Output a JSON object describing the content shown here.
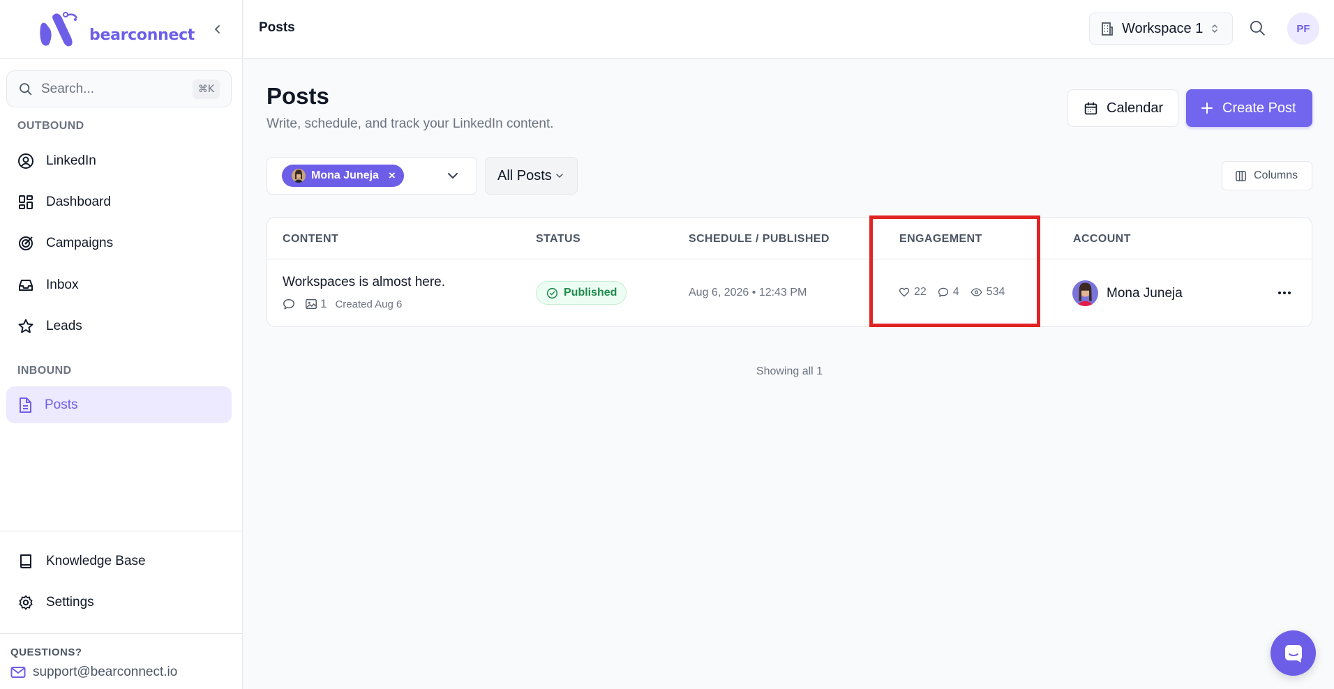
{
  "app": {
    "brand": "bearconnect",
    "brand_color": "#6d5ee8"
  },
  "sidebar": {
    "search": {
      "placeholder": "Search...",
      "shortcut": "⌘K"
    },
    "sections": {
      "outbound": "OUTBOUND",
      "inbound": "INBOUND"
    },
    "items": [
      {
        "label": "LinkedIn",
        "icon": "user-circle-icon"
      },
      {
        "label": "Dashboard",
        "icon": "dashboard-icon"
      },
      {
        "label": "Campaigns",
        "icon": "target-icon"
      },
      {
        "label": "Inbox",
        "icon": "inbox-icon"
      },
      {
        "label": "Leads",
        "icon": "star-icon"
      },
      {
        "label": "Posts",
        "icon": "document-icon",
        "active": true
      }
    ],
    "bottom": [
      {
        "label": "Knowledge Base",
        "icon": "book-icon"
      },
      {
        "label": "Settings",
        "icon": "gear-icon"
      }
    ],
    "questions": {
      "label": "QUESTIONS?",
      "email": "support@bearconnect.io"
    }
  },
  "topbar": {
    "title": "Posts",
    "workspace": "Workspace 1",
    "avatar_initials": "PF"
  },
  "page": {
    "title": "Posts",
    "subtitle": "Write, schedule, and track your LinkedIn content.",
    "calendar_label": "Calendar",
    "create_label": "Create Post",
    "filter_chip": "Mona Juneja",
    "filter_remove": "×",
    "post_type": "All Posts",
    "columns_label": "Columns"
  },
  "table": {
    "headers": [
      "CONTENT",
      "STATUS",
      "SCHEDULE / PUBLISHED",
      "ENGAGEMENT",
      "ACCOUNT"
    ],
    "rows": [
      {
        "title": "Workspaces is almost here.",
        "media_count": "1",
        "created": "Created Aug 6",
        "status": "Published",
        "schedule": "Aug 6, 2026 • 12:43 PM",
        "likes": "22",
        "comments": "4",
        "views": "534",
        "account": "Mona Juneja"
      }
    ],
    "footer": "Showing all 1"
  }
}
